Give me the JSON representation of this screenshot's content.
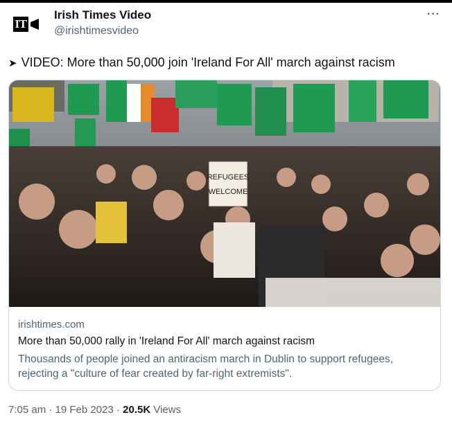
{
  "author": {
    "logo_text": "IT",
    "name": "Irish Times Video",
    "handle": "@irishtimesvideo"
  },
  "more_label": "···",
  "tweet": {
    "text": "VIDEO: More than 50,000 join 'Ireland For All' march against racism",
    "arrow_icon": "right-pointer-icon"
  },
  "card": {
    "image": {
      "sign_line1": "REFUGEES",
      "sign_line2": "WELCOME"
    },
    "domain": "irishtimes.com",
    "title": "More than 50,000 rally in 'Ireland For All' march against racism",
    "description": "Thousands of people joined an antiracism march in Dublin to support refugees, rejecting a \"culture of fear created by far-right extremists\"."
  },
  "meta": {
    "time": "7:05 am",
    "separator": "·",
    "date": "19 Feb 2023",
    "views_count": "20.5K",
    "views_label": "Views"
  },
  "colors": {
    "secondary_text": "#536471",
    "border": "#cfd9de",
    "flag_green": "#1e9a52"
  }
}
